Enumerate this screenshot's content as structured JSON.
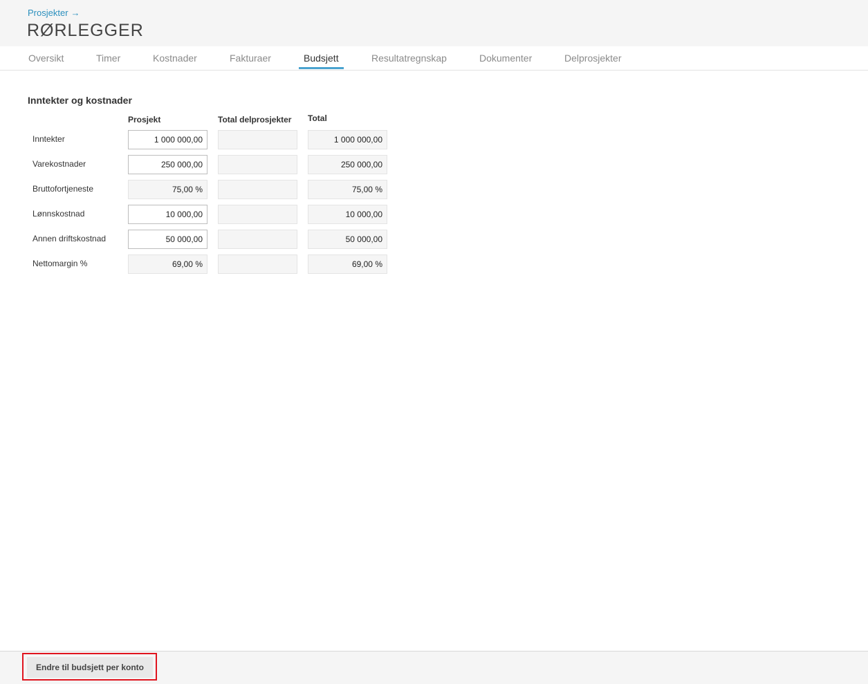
{
  "header": {
    "breadcrumb": "Prosjekter",
    "breadcrumb_arrow": "→",
    "title": "RØRLEGGER"
  },
  "tabs": [
    {
      "label": "Oversikt"
    },
    {
      "label": "Timer"
    },
    {
      "label": "Kostnader"
    },
    {
      "label": "Fakturaer"
    },
    {
      "label": "Budsjett"
    },
    {
      "label": "Resultatregnskap"
    },
    {
      "label": "Dokumenter"
    },
    {
      "label": "Delprosjekter"
    }
  ],
  "active_tab": "Budsjett",
  "budget": {
    "section_title": "Inntekter og kostnader",
    "columns": {
      "project": "Prosjekt",
      "subprojects": "Total delprosjekter",
      "total": "Total"
    },
    "rows": [
      {
        "label": "Inntekter",
        "project": "1 000 000,00",
        "subprojects": "",
        "total": "1 000 000,00"
      },
      {
        "label": "Varekostnader",
        "project": "250 000,00",
        "subprojects": "",
        "total": "250 000,00"
      },
      {
        "label": "Bruttofortjeneste",
        "project": "75,00 %",
        "subprojects": "",
        "total": "75,00 %"
      },
      {
        "label": "Lønnskostnad",
        "project": "10 000,00",
        "subprojects": "",
        "total": "10 000,00"
      },
      {
        "label": "Annen driftskostnad",
        "project": "50 000,00",
        "subprojects": "",
        "total": "50 000,00"
      },
      {
        "label": "Nettomargin %",
        "project": "69,00 %",
        "subprojects": "",
        "total": "69,00 %"
      }
    ]
  },
  "footer": {
    "change_button": "Endre til budsjett per konto"
  },
  "colors": {
    "accent": "#4aa3cf",
    "link": "#2a8fbd",
    "highlight": "#e0141e"
  }
}
